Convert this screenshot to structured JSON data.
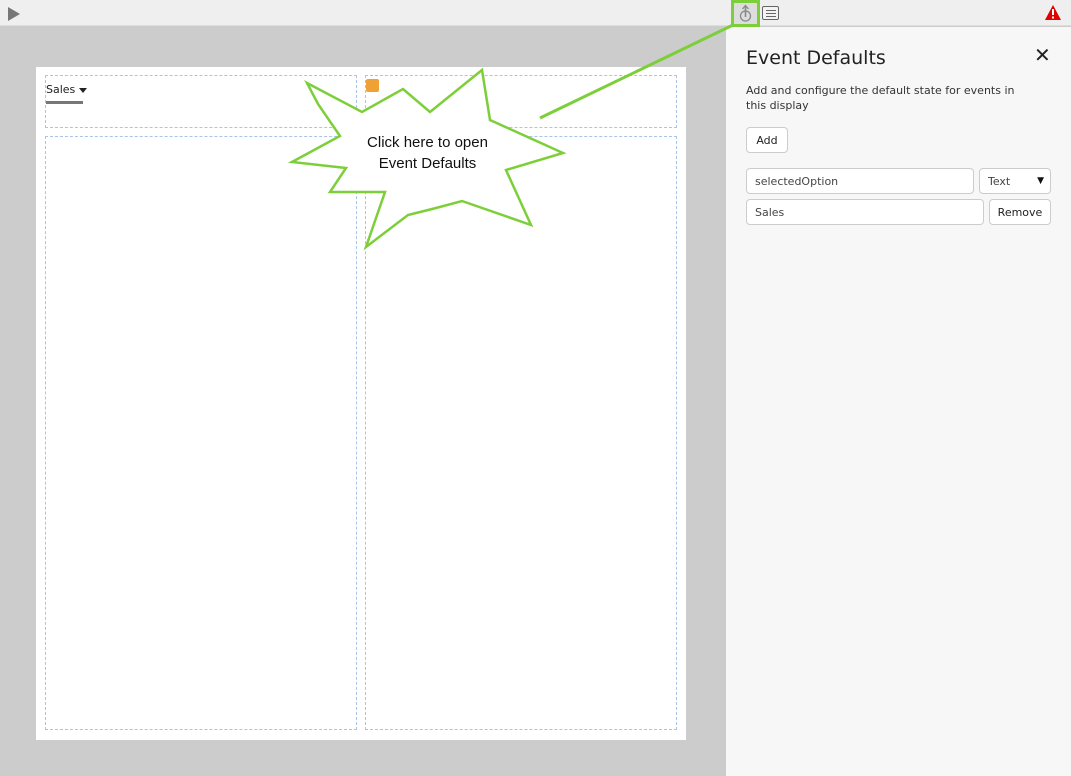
{
  "toolbar": {
    "play_icon": "play-icon",
    "event_defaults_icon": "event-defaults-icon",
    "list_icon": "list-icon",
    "warning_icon": "warning-icon"
  },
  "canvas": {
    "dropdown_label": "Sales"
  },
  "panel": {
    "title": "Event Defaults",
    "description": "Add and configure the default state for events in this display",
    "add_label": "Add",
    "event_name": "selectedOption",
    "event_type": "Text",
    "event_value": "Sales",
    "remove_label": "Remove"
  },
  "callout": {
    "text": "Click here to open Event Defaults"
  },
  "colors": {
    "highlight": "#7dcf3a",
    "orange": "#f0a136",
    "warning": "#e00000"
  }
}
